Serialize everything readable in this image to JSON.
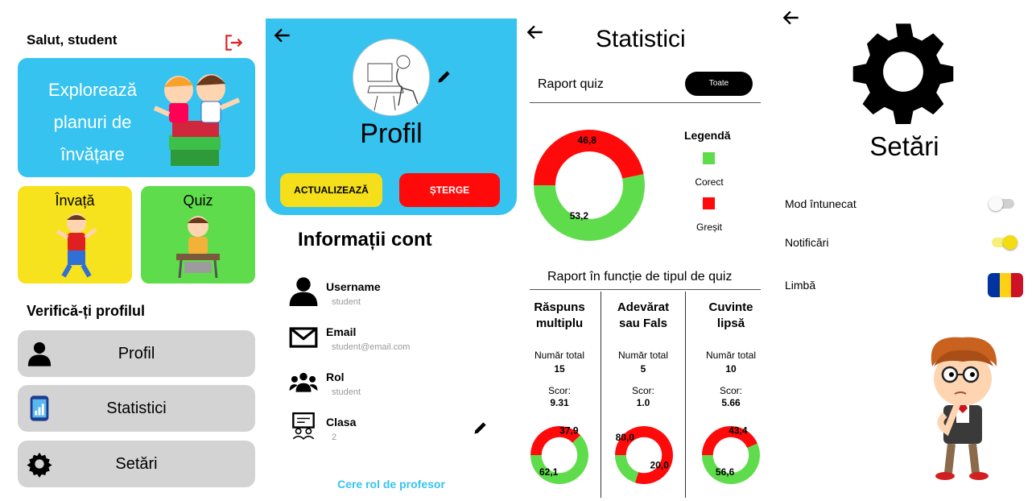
{
  "home": {
    "greeting": "Salut, student",
    "explore_label": "Explorează planuri de învățare",
    "learn_label": "Învață",
    "quiz_label": "Quiz",
    "verify_title": "Verifică-ți profilul",
    "menu": [
      {
        "label": "Profil",
        "icon": "person-icon"
      },
      {
        "label": "Statistici",
        "icon": "phone-chart-icon"
      },
      {
        "label": "Setări",
        "icon": "gear-icon"
      }
    ]
  },
  "profile": {
    "title": "Profil",
    "update_label": "ACTUALIZEAZĂ",
    "delete_label": "ȘTERGE",
    "account_title": "Informații cont",
    "fields": [
      {
        "label": "Username",
        "value": "student",
        "icon": "person-icon"
      },
      {
        "label": "Email",
        "value": "student@email.com",
        "icon": "mail-icon"
      },
      {
        "label": "Rol",
        "value": "student",
        "icon": "group-icon"
      },
      {
        "label": "Clasa",
        "value": "2",
        "icon": "classroom-icon"
      }
    ],
    "teacher_link": "Cere rol de profesor"
  },
  "stats": {
    "title": "Statistici",
    "report_label": "Raport quiz",
    "filter_label": "Toate",
    "legend_title": "Legendă",
    "legend": [
      {
        "label": "Corect",
        "color": "#5fdc4b"
      },
      {
        "label": "Greșit",
        "color": "#ff0a0a"
      }
    ],
    "overall": {
      "wrong": "46,8",
      "correct": "53,2"
    },
    "type_title": "Raport în funcție de tipul de quiz",
    "total_label": "Număr total",
    "score_label": "Scor:",
    "types": [
      {
        "name_l1": "Răspuns",
        "name_l2": "multiplu",
        "total": "15",
        "score": "9.31",
        "wrong": "37,9",
        "correct": "62,1"
      },
      {
        "name_l1": "Adevărat",
        "name_l2": "sau Fals",
        "total": "5",
        "score": "1.0",
        "wrong": "80,0",
        "correct": "20,0"
      },
      {
        "name_l1": "Cuvinte",
        "name_l2": "lipsă",
        "total": "10",
        "score": "5.66",
        "wrong": "43,4",
        "correct": "56,6"
      }
    ]
  },
  "settings": {
    "title": "Setări",
    "dark_mode_label": "Mod întunecat",
    "dark_mode_on": false,
    "notifications_label": "Notificări",
    "notifications_on": true,
    "language_label": "Limbă",
    "language_flag": "romania-flag-icon"
  },
  "chart_data": [
    {
      "type": "pie",
      "title": "",
      "categories": [
        "Corect",
        "Greșit"
      ],
      "values": [
        53.2,
        46.8
      ]
    },
    {
      "type": "pie",
      "title": "",
      "categories": [
        "Corect",
        "Greșit"
      ],
      "values": [
        62.1,
        37.9
      ]
    },
    {
      "type": "pie",
      "title": "",
      "categories": [
        "Corect",
        "Greșit"
      ],
      "values": [
        20.0,
        80.0
      ]
    },
    {
      "type": "pie",
      "title": "",
      "categories": [
        "Corect",
        "Greșit"
      ],
      "values": [
        56.6,
        43.4
      ]
    }
  ]
}
